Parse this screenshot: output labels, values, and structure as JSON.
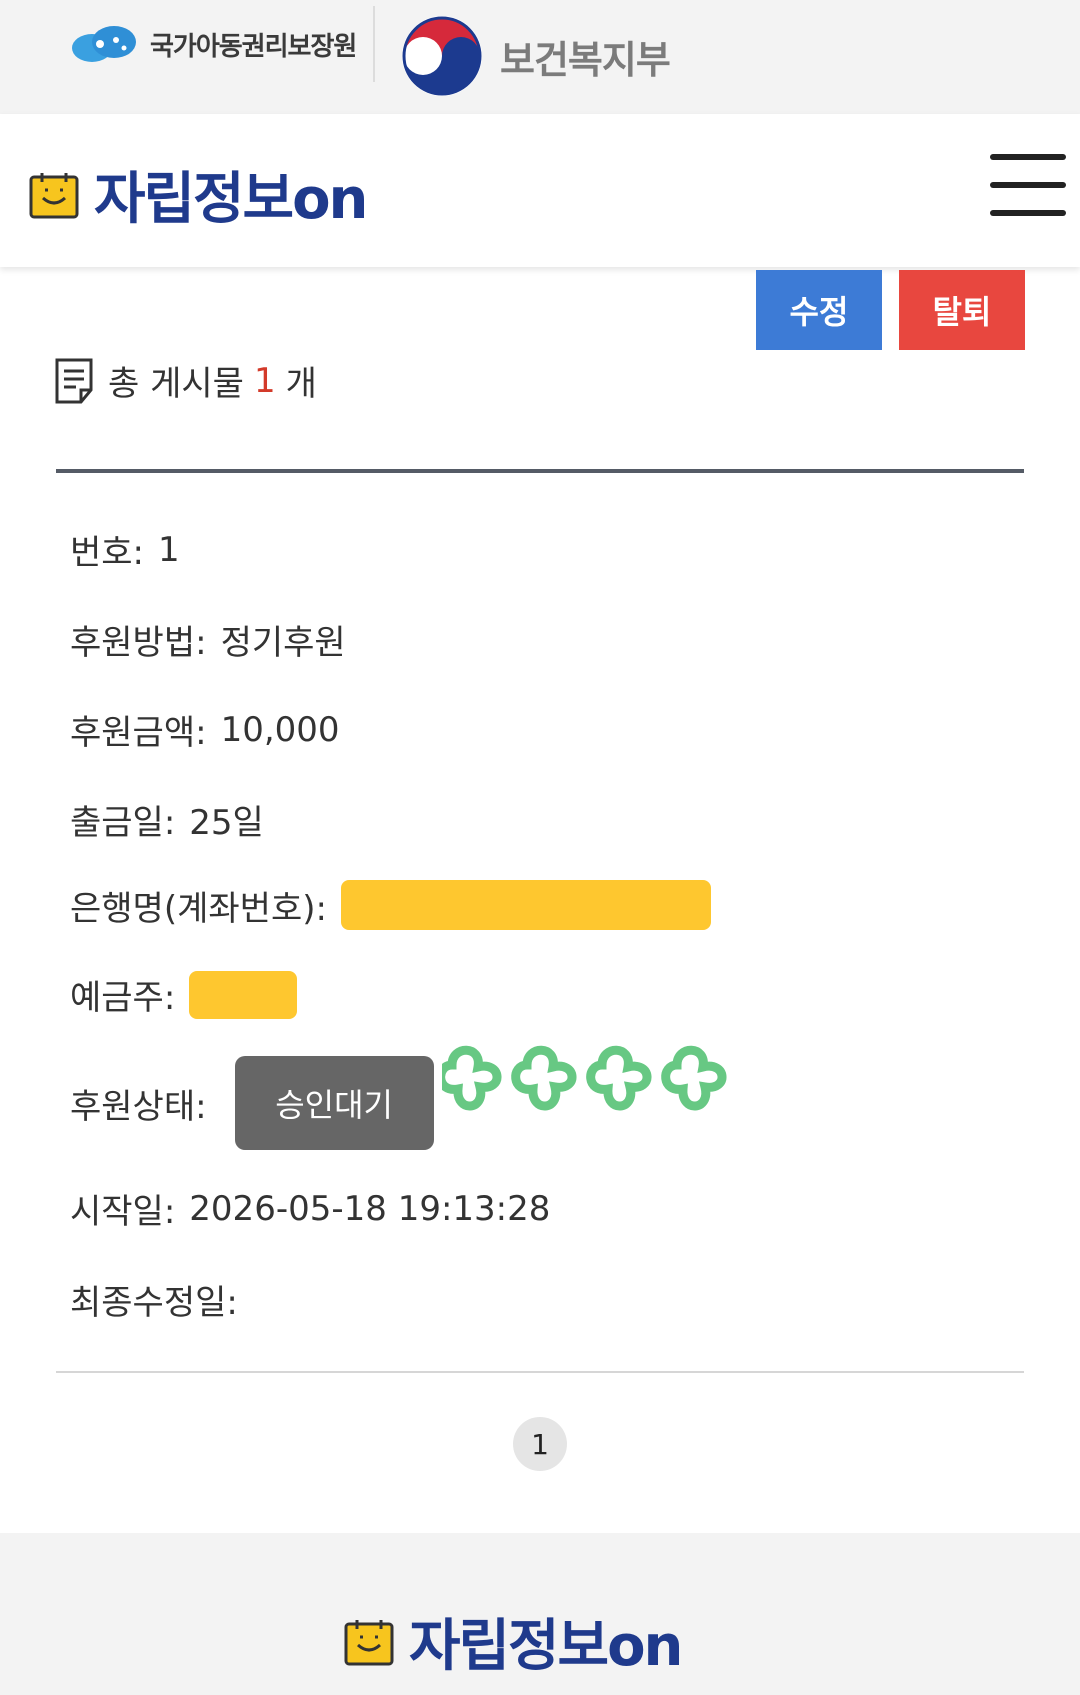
{
  "partners": {
    "ncrc_name": "국가아동권리보장원",
    "mohw_name": "보건복지부"
  },
  "header": {
    "brand": "자립정보on",
    "menu_icon": "hamburger-menu-icon"
  },
  "actions": {
    "edit_label": "수정",
    "withdraw_label": "탈퇴"
  },
  "summary": {
    "prefix": "총 게시물",
    "count": "1",
    "suffix": "개"
  },
  "record": {
    "number_label": "번호:",
    "number_value": "1",
    "method_label": "후원방법:",
    "method_value": "정기후원",
    "amount_label": "후원금액:",
    "amount_value": "10,000",
    "withdraw_day_label": "출금일:",
    "withdraw_day_value": "25일",
    "bank_label": "은행명(계좌번호):",
    "holder_label": "예금주:",
    "status_label": "후원상태:",
    "status_value": "승인대기",
    "start_label": "시작일:",
    "start_value": "2026-05-18 19:13:28",
    "modified_label": "최종수정일:",
    "modified_value": ""
  },
  "pagination": {
    "current_page": "1"
  },
  "footer": {
    "brand": "자립정보on"
  },
  "colors": {
    "brand_navy": "#1f3a8c",
    "edit_blue": "#3d7bd6",
    "withdraw_red": "#e8473f",
    "status_gray": "#666666",
    "redaction_yellow": "#fec72f",
    "count_red": "#d33a2a"
  }
}
